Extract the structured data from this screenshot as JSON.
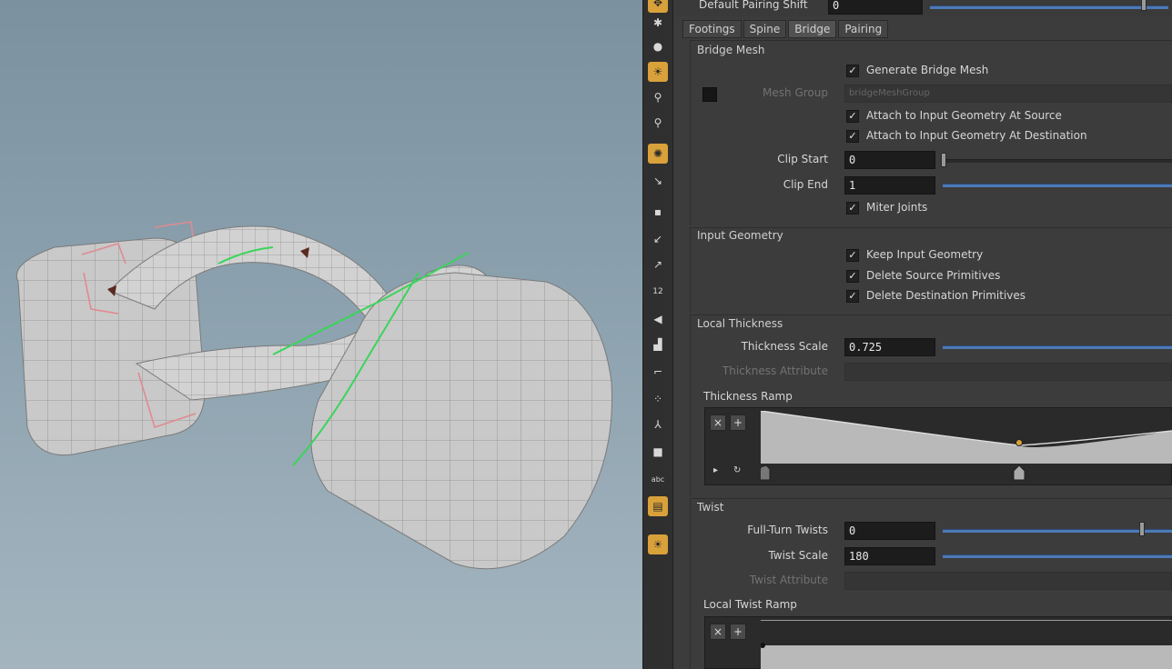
{
  "parameters": {
    "default_pairing_shift": {
      "label": "Default Pairing Shift",
      "value": "0"
    },
    "tabs": [
      "Footings",
      "Spine",
      "Bridge",
      "Pairing"
    ],
    "selected_tab": "Bridge",
    "bridge_mesh": {
      "title": "Bridge Mesh",
      "generate": "Generate Bridge Mesh",
      "mesh_group_label": "Mesh Group",
      "mesh_group_value": "bridgeMeshGroup",
      "attach_source": "Attach to Input Geometry At Source",
      "attach_dest": "Attach to Input Geometry At Destination",
      "clip_start_label": "Clip Start",
      "clip_start": "0",
      "clip_end_label": "Clip End",
      "clip_end": "1",
      "miter": "Miter Joints"
    },
    "input_geometry": {
      "title": "Input Geometry",
      "keep": "Keep Input Geometry",
      "delete_source": "Delete Source Primitives",
      "delete_dest": "Delete Destination Primitives"
    },
    "local_thickness": {
      "title": "Local Thickness",
      "scale_label": "Thickness Scale",
      "scale": "0.725",
      "attr_label": "Thickness Attribute",
      "ramp_label": "Thickness Ramp"
    },
    "twist": {
      "title": "Twist",
      "full_turn_label": "Full-Turn Twists",
      "full_turn": "0",
      "scale_label": "Twist Scale",
      "scale": "180",
      "attr_label": "Twist Attribute",
      "ramp_label": "Local Twist Ramp"
    },
    "ramp_buttons": {
      "remove": "×",
      "add": "+",
      "play": "▸",
      "loop": "↻"
    }
  },
  "shelf_icons": [
    "move-icon",
    "sphere-icon",
    "light-icon",
    "pin-icon",
    "magnet-icon",
    "view-icon",
    "snap-icon",
    "dot-icon",
    "arrow-icon",
    "pen-icon",
    "number-icon",
    "paint-icon",
    "stamp-icon",
    "bracket-icon",
    "scatter-icon",
    "branch-icon",
    "square-icon",
    "text-icon",
    "file-icon",
    "bulb-icon"
  ],
  "shelf_text": {
    "number": "12",
    "text": "abc"
  },
  "accent": "#d9a13a",
  "slider_color": "#4d7ab5"
}
